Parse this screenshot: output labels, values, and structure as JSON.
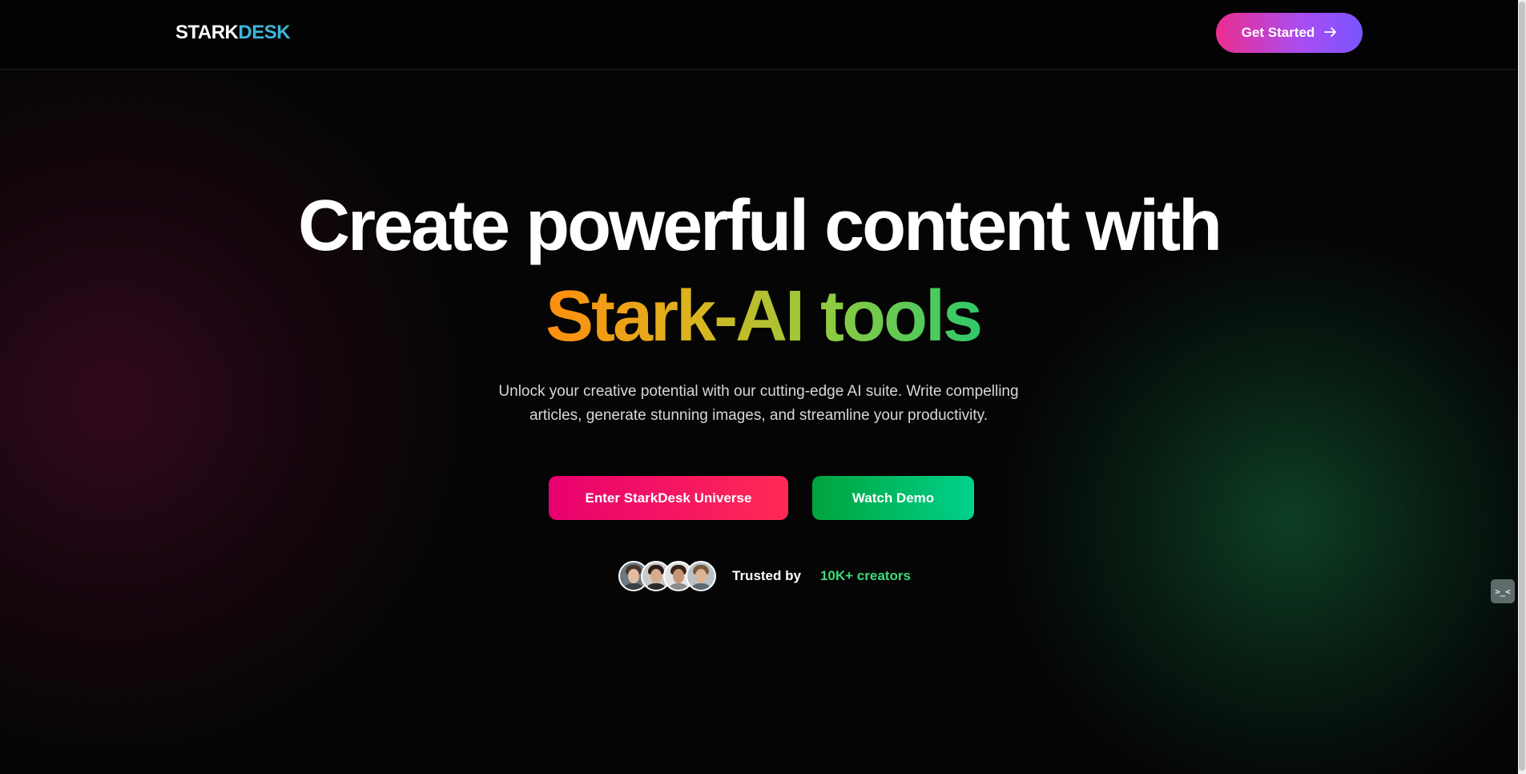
{
  "nav": {
    "logo_part1": "STARK",
    "logo_part2": "DESK",
    "cta_label": "Get Started",
    "cta_icon": "arrow-right-icon"
  },
  "hero": {
    "title_line1": "Create powerful content with",
    "title_line2": "Stark-AI tools",
    "subtitle": "Unlock your creative potential with our cutting-edge AI suite. Write compelling articles, generate stunning images, and streamline your productivity.",
    "primary_button": "Enter StarkDesk Universe",
    "secondary_button": "Watch Demo"
  },
  "trust": {
    "label": "Trusted by",
    "count": "10K+ creators",
    "avatars": [
      "avatar-1",
      "avatar-2",
      "avatar-3",
      "avatar-4"
    ]
  },
  "chat_widget": {
    "glyph": ">_<"
  },
  "colors": {
    "logo_accent": "#3fb6d9",
    "cta_gradient_start": "#ec2d8f",
    "cta_gradient_end": "#7a55ff",
    "primary_button": "#e8006f",
    "secondary_button": "#00c06a",
    "trust_count": "#3fd97a",
    "title_gradient_start": "#ff8e0d",
    "title_gradient_end": "#2ec96b"
  }
}
